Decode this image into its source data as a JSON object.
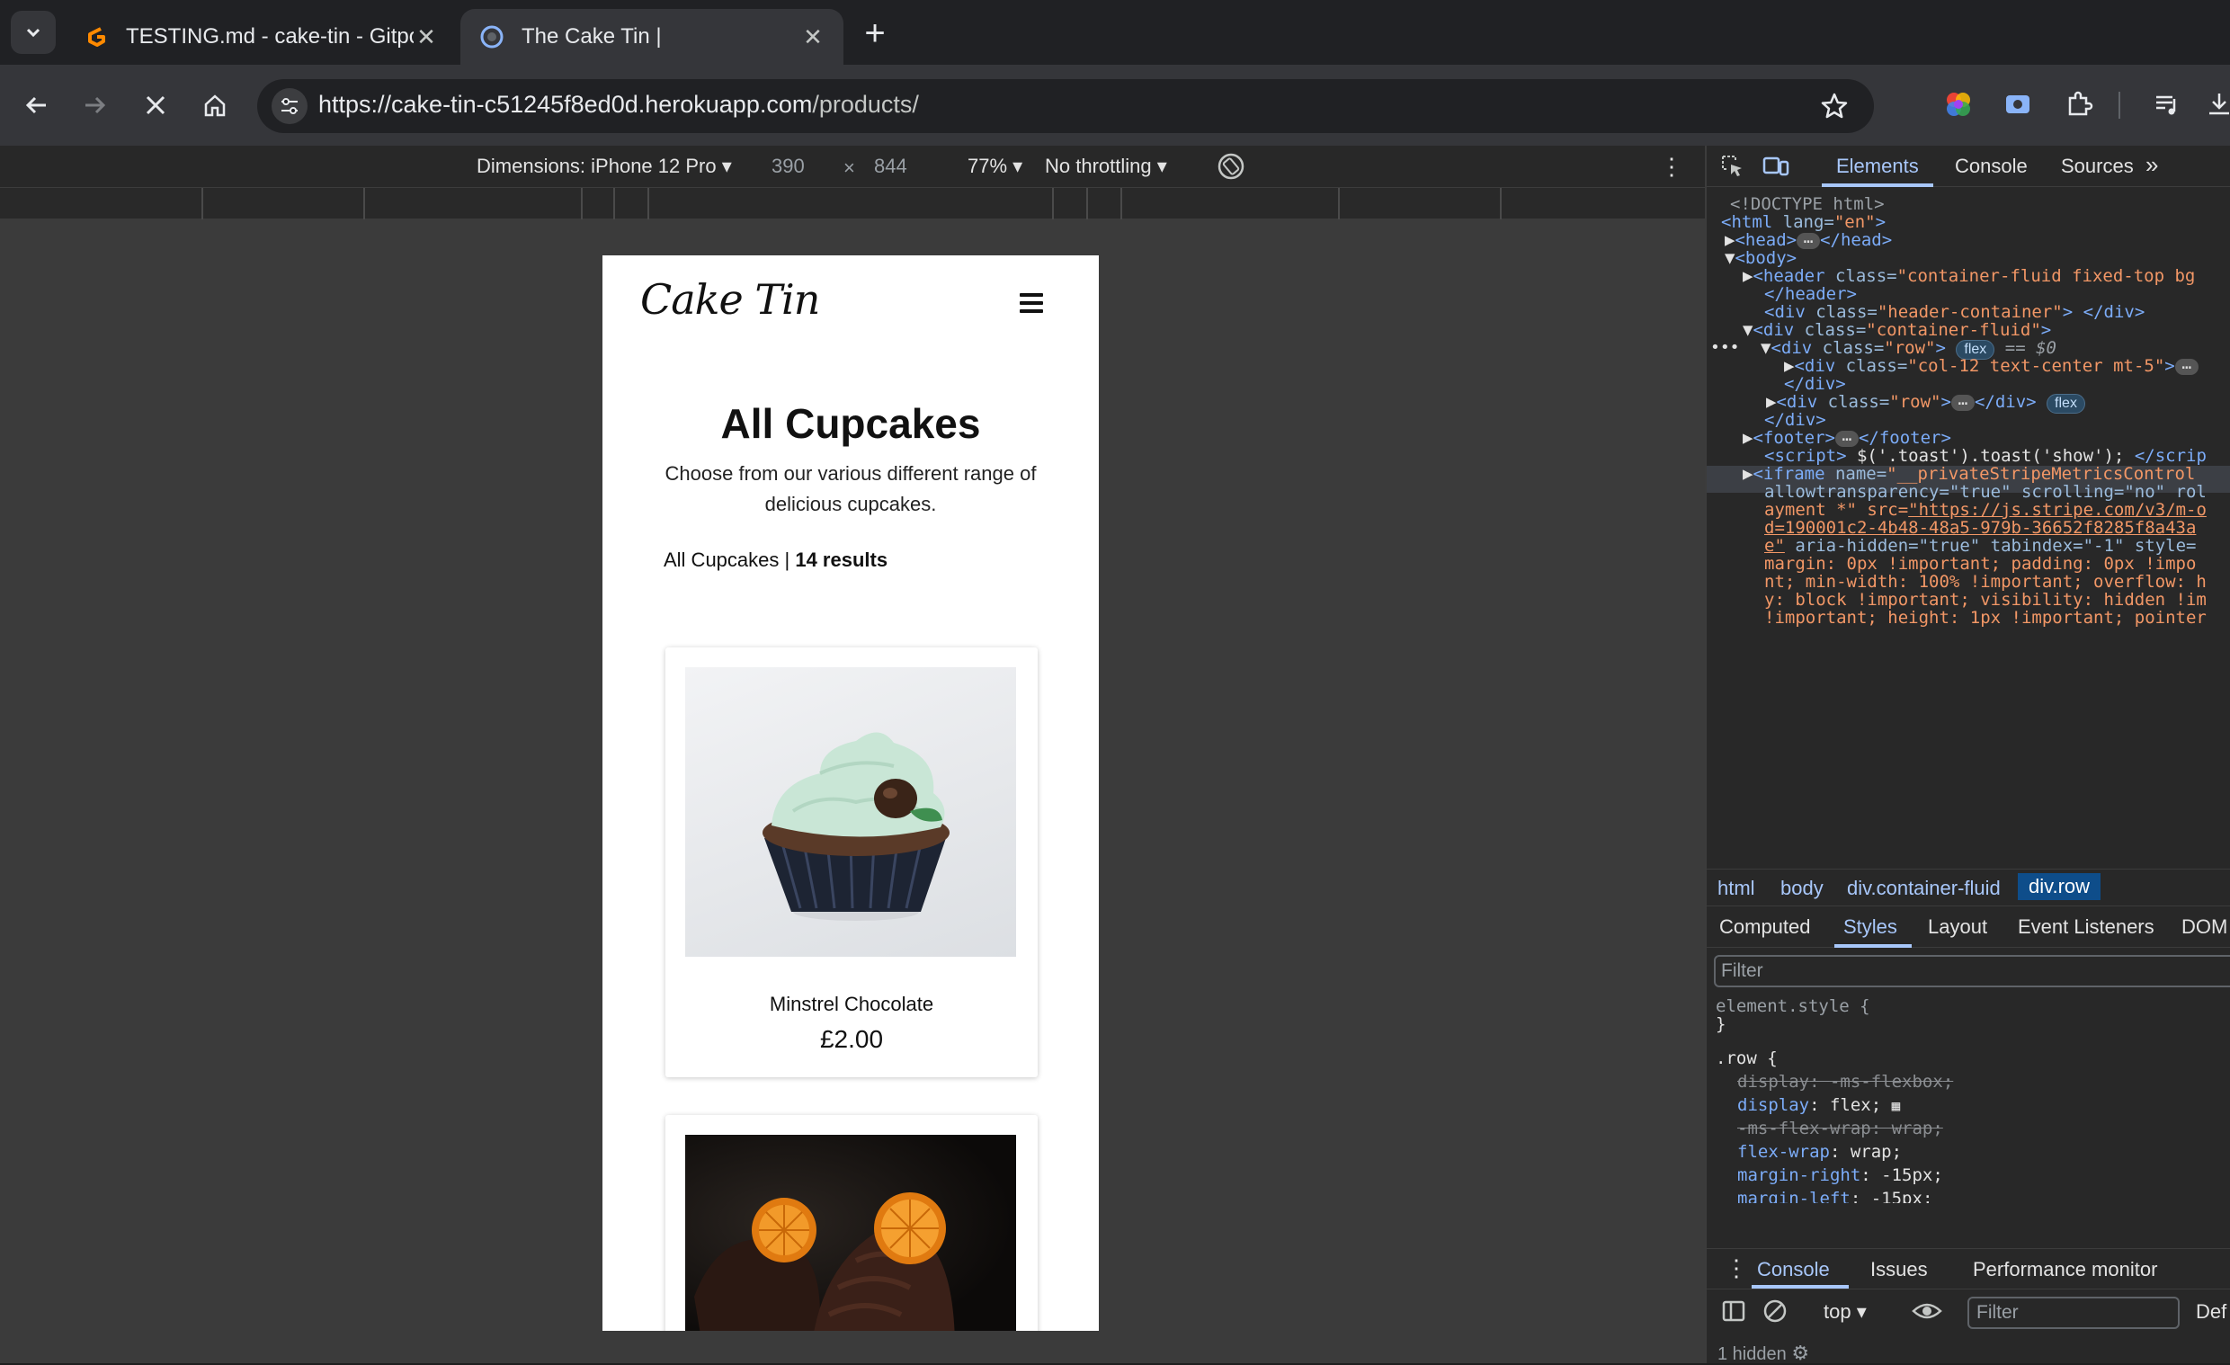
{
  "browser": {
    "tabs": [
      {
        "title": "TESTING.md - cake-tin - Gitpod",
        "active": false
      },
      {
        "title": "The Cake Tin |",
        "active": true
      }
    ],
    "url_host": "https://cake-tin-c51245f8ed0d.herokuapp.com",
    "url_path": "/products/"
  },
  "device_toolbar": {
    "dimensions_label": "Dimensions: iPhone 12 Pro",
    "width": "390",
    "times": "×",
    "height": "844",
    "zoom": "77%",
    "throttling": "No throttling"
  },
  "page": {
    "logo": "Cake Tin",
    "title": "All Cupcakes",
    "subtitle": "Choose from our various different range of delicious cupcakes.",
    "results_prefix": "All Cupcakes | ",
    "results_count": "14 results",
    "products": [
      {
        "name": "Minstrel Chocolate",
        "price": "£2.00"
      },
      {
        "name": "",
        "price": ""
      }
    ]
  },
  "devtools": {
    "tabs": [
      "Elements",
      "Console",
      "Sources"
    ],
    "active_tab": "Elements",
    "dom_lines": {
      "l1": "<!DOCTYPE html>",
      "l2_tag": "<html",
      "l2_attr": " lang=",
      "l2_val": "\"en\"",
      "l3_open": "<head>",
      "l3_close": "</head>",
      "l4": "<body>",
      "l5_tag": "<header",
      "l5_attr": " class=",
      "l5_val": "\"container-fluid fixed-top bg",
      "l6": "</header>",
      "l7_tag": "<div",
      "l7_attr": " class=",
      "l7_val": "\"header-container\"",
      "l7_close": "> </div>",
      "l8_tag": "<div",
      "l8_attr": " class=",
      "l8_val": "\"container-fluid\"",
      "l9_tag": "<div",
      "l9_attr": " class=",
      "l9_val": "\"row\"",
      "l9_badge": "flex",
      "l9_eq": " == $0",
      "l10_tag": "<div",
      "l10_attr": " class=",
      "l10_val": "\"col-12 text-center mt-5\"",
      "l11": "</div>",
      "l12_tag": "<div",
      "l12_attr": " class=",
      "l12_val": "\"row\"",
      "l12_close": "</div>",
      "l12_badge": "flex",
      "l13": "</div>",
      "l14_open": "<footer>",
      "l14_close": "</footer>",
      "l15_tag": "<script>",
      "l15_code": " $('.toast').toast('show'); ",
      "l15_close": "</scrip",
      "l16_tag": "<iframe",
      "l16_attr": " name=",
      "l16_val": "\"__privateStripeMetricsControl",
      "l17": "allowtransparency=\"true\" scrolling=\"no\" rol",
      "l18_a": "ayment *\" src=",
      "l18_link": "\"https://js.stripe.com/v3/m-o",
      "l19_link": "d=190001c2-4b48-48a5-979b-36652f8285f8a43a",
      "l20_link": "e\"",
      "l20_rest": " aria-hidden=\"true\" tabindex=\"-1\" style=",
      "l21": "margin: 0px !important; padding: 0px !impo",
      "l22": "nt; min-width: 100% !important; overflow: h",
      "l23": "y: block !important; visibility: hidden !im",
      "l24": "!important; height: 1px !important; pointer"
    },
    "breadcrumbs": [
      "html",
      "body",
      "div.container-fluid",
      "div.row"
    ],
    "subtabs": [
      "Computed",
      "Styles",
      "Layout",
      "Event Listeners",
      "DOM"
    ],
    "active_subtab": "Styles",
    "filter_placeholder": "Filter",
    "styles": {
      "element_style": "element.style {",
      "close1": "}",
      "row_sel": ".row {",
      "p1_name": "display",
      "p1_val": "-ms-flexbox",
      "p2_name": "display",
      "p2_val": "flex",
      "p3_name": "-ms-flex-wrap",
      "p3_val": "wrap",
      "p4_name": "flex-wrap",
      "p4_val": "wrap",
      "p5_name": "margin-right",
      "p5_val": "-15px",
      "p6_name": "margin-left",
      "p6_val": "-15px",
      "close2": "}"
    },
    "drawer_tabs": [
      "Console",
      "Issues",
      "Performance monitor"
    ],
    "console_context": "top",
    "console_filter": "Filter",
    "console_level": "Def",
    "hidden_count": "1 hidden"
  },
  "colors": {
    "accent": "#a8c7fa",
    "gitpod_orange": "#ff8a00"
  }
}
